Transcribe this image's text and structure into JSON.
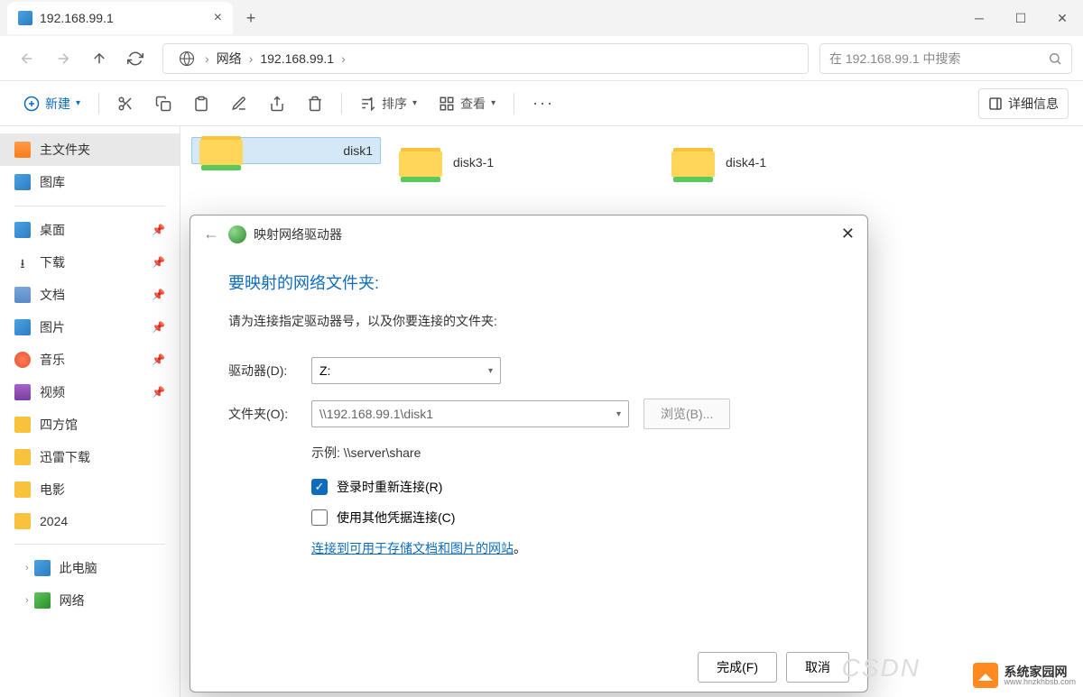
{
  "tab": {
    "title": "192.168.99.1"
  },
  "breadcrumb": {
    "items": [
      "网络",
      "192.168.99.1"
    ]
  },
  "search": {
    "placeholder": "在 192.168.99.1 中搜索"
  },
  "toolbar": {
    "new_label": "新建",
    "sort_label": "排序",
    "view_label": "查看",
    "details_label": "详细信息"
  },
  "sidebar": {
    "home": "主文件夹",
    "gallery": "图库",
    "desktop": "桌面",
    "downloads": "下载",
    "documents": "文档",
    "pictures": "图片",
    "music": "音乐",
    "videos": "视频",
    "sifang": "四方馆",
    "xunlei": "迅雷下载",
    "movies": "电影",
    "y2024": "2024",
    "this_pc": "此电脑",
    "network": "网络"
  },
  "folders": [
    {
      "name": "disk1"
    },
    {
      "name": "disk3-1"
    },
    {
      "name": "disk4-1"
    }
  ],
  "dialog": {
    "title": "映射网络驱动器",
    "heading": "要映射的网络文件夹:",
    "subtitle": "请为连接指定驱动器号，以及你要连接的文件夹:",
    "drive_label": "驱动器(D):",
    "drive_value": "Z:",
    "folder_label": "文件夹(O):",
    "folder_value": "\\\\192.168.99.1\\disk1",
    "browse_label": "浏览(B)...",
    "example": "示例: \\\\server\\share",
    "cb1": "登录时重新连接(R)",
    "cb2": "使用其他凭据连接(C)",
    "link": "连接到可用于存储文档和图片的网站",
    "finish": "完成(F)",
    "cancel": "取消"
  },
  "watermark": {
    "csdn": "CSDN",
    "cn": "系统家园网",
    "en": "www.hnzkhbsb.com"
  }
}
